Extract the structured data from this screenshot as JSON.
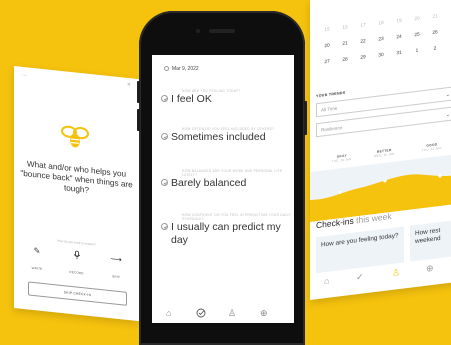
{
  "left_card": {
    "question": "What and/or who helps you \"bounce back\" when things are tough?",
    "prompt": "How do you want to answer?",
    "actions": [
      {
        "icon": "pencil-icon",
        "label": "WRITE"
      },
      {
        "icon": "microphone-icon",
        "label": "RECORD"
      },
      {
        "icon": "arrow-right-icon",
        "label": "SKIP"
      }
    ],
    "skip_button": "SKIP CHECK-IN"
  },
  "phone": {
    "date": "Mar 9, 2022",
    "entries": [
      {
        "question": "HOW ARE YOU FEELING TODAY?",
        "answer": "I feel OK"
      },
      {
        "question": "HOW OFTEN DO YOU FEEL INCLUDED BY OTHERS?",
        "answer": "Sometimes included"
      },
      {
        "question": "HOW BALANCED ARE YOUR WORK AND PERSONAL LIFE LATELY?",
        "answer": "Barely balanced"
      },
      {
        "question": "HOW CONFIDENT DO YOU FEEL IN PREDICTING YOUR DAILY SCHEDULE?",
        "answer": "I usually can predict my day"
      }
    ],
    "tabs": [
      "home-icon",
      "checkin-icon",
      "profile-icon",
      "settings-icon"
    ]
  },
  "right_card": {
    "calendar": [
      [
        "15",
        "16",
        "17",
        "18",
        "19",
        "20",
        "21"
      ],
      [
        "20",
        "21",
        "22",
        "23",
        "24",
        "25",
        "26"
      ],
      [
        "27",
        "28",
        "29",
        "30",
        "31",
        "1",
        "2"
      ]
    ],
    "trends_label": "YOUR TRENDS",
    "range_select": "All Time",
    "metric_select": "Resilience",
    "moods": [
      {
        "label": "OKAY",
        "sub": "TUE, 29 JAN"
      },
      {
        "label": "BETTER",
        "sub": "WED, 30 JAN"
      },
      {
        "label": "GOOD",
        "sub": "THU, 31 JAN"
      }
    ],
    "checkins_title": "Check-ins",
    "checkins_suffix": "this week",
    "cards": [
      "How are you feeling today?",
      "How rest weekend"
    ],
    "accent": "#f5c20e"
  }
}
